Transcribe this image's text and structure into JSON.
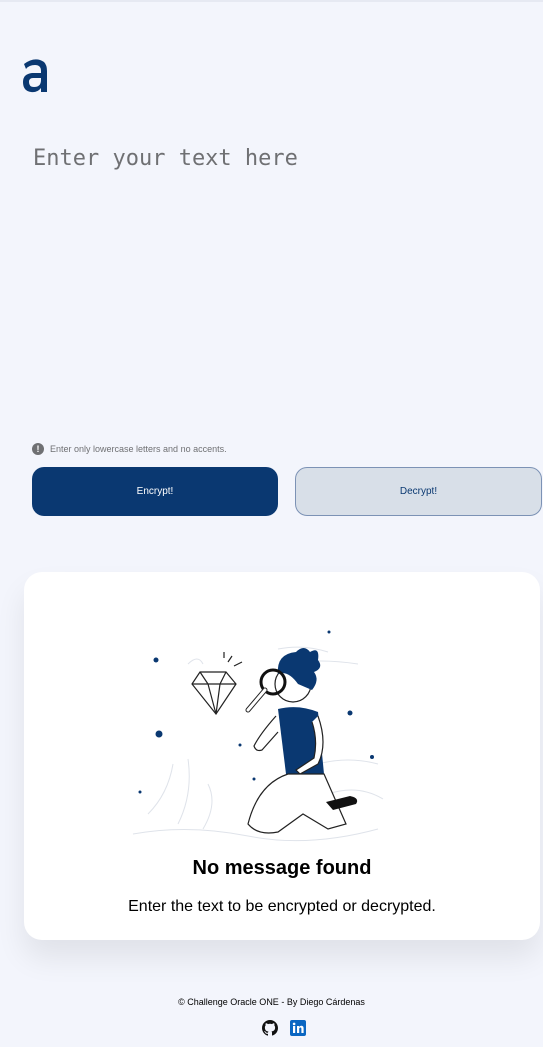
{
  "logo": {
    "letter": "a",
    "color": "#0a3871"
  },
  "editor": {
    "placeholder": "Enter your text here"
  },
  "hint": {
    "icon": "exclamation-icon",
    "text": "Enter only lowercase letters and no accents."
  },
  "buttons": {
    "encrypt_label": "Encrypt!",
    "decrypt_label": "Decrypt!"
  },
  "output": {
    "illustration": "person-with-magnifying-glass-and-diamond",
    "title": "No message found",
    "subtitle": "Enter the text to be encrypted or decrypted."
  },
  "footer": {
    "credit": "© Challenge Oracle ONE - By Diego Cárdenas",
    "icons": [
      "github-icon",
      "linkedin-icon"
    ]
  },
  "colors": {
    "primary": "#0a3871",
    "background": "#f3f5fc",
    "secondary": "#d8dfe8"
  }
}
